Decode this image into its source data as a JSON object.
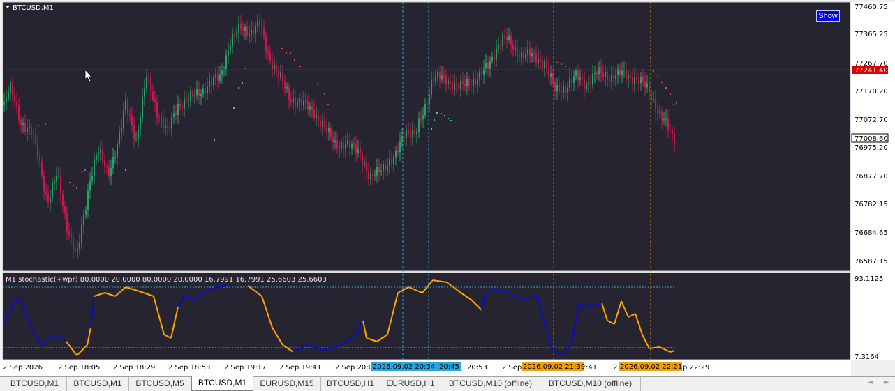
{
  "chart": {
    "title": "BTCUSD,M1",
    "show_button": "Show",
    "price_axis": [
      "77460.75",
      "77365.25",
      "77267.70",
      "77170.20",
      "77072.70",
      "76975.20",
      "76877.70",
      "76782.15",
      "76684.65",
      "76587.15"
    ],
    "current_price": "77241.40",
    "bid_price": "77008.60",
    "colors": {
      "bull": "#26a269",
      "bear": "#c8194b",
      "background": "#262431",
      "current_line": "#c00000",
      "sar_bull": "#4ec88a",
      "sar_bear": "#e0405a"
    }
  },
  "indicator": {
    "label": "M1 stochastic(+wpr) 80.0000 20.0000 80.0000 20.0000 16.7991 16.7991 25.6603 25.6603",
    "axis_top": "93.1125",
    "axis_bottom": "7.3164",
    "colors": {
      "up": "#0a0ad2",
      "down": "#ffa500",
      "level_high": "#3c9fd0",
      "level_low": "#e8a000"
    }
  },
  "time_axis": {
    "labels": [
      "2 Sep 2026",
      "2 Sep 18:05",
      "2 Sep 18:29",
      "2 Sep 18:53",
      "2 Sep 19:17",
      "2 Sep 19:41",
      "2 Sep 20:0",
      "20:53",
      "2 Sep",
      ":41",
      "2",
      "p 22:29"
    ],
    "highlights": [
      {
        "text": "2026.09.02 20:34",
        "color": "#29a8e0"
      },
      {
        "text": "20:45",
        "color": "#29a8e0"
      },
      {
        "text": "2026.09.02 21:39",
        "color": "#f0a000"
      },
      {
        "text": "2026.09.02 22:21",
        "color": "#f0a000"
      }
    ]
  },
  "tabs": [
    "BTCUSD,M1",
    "BTCUSD,M1",
    "BTCUSD,M5",
    "BTCUSD,M1",
    "EURUSD,M15",
    "BTCUSD,H1",
    "EURUSD,H1",
    "BTCUSD,M10 (offline)",
    "BTCUSD,M10 (offline)"
  ],
  "active_tab": 3,
  "tab_scroll": {
    "left": "◄",
    "right": "►"
  }
}
